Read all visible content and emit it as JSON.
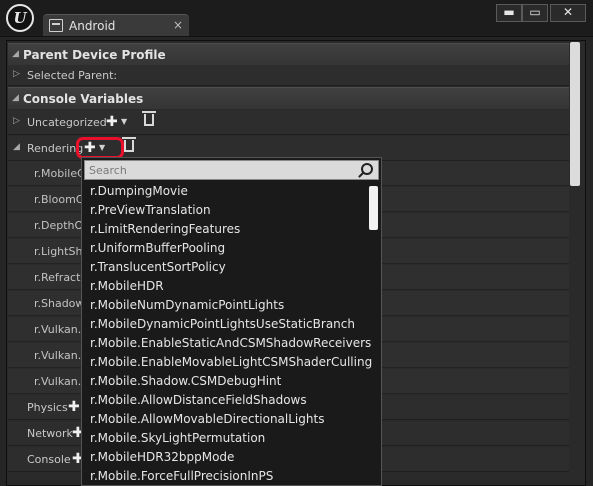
{
  "window": {
    "tab_label": "Android",
    "tab_close": "×",
    "minimize": "▬",
    "maximize": "▭",
    "close": "✕"
  },
  "sections": {
    "parent_device_profile": "Parent Device Profile",
    "selected_parent": "Selected Parent:",
    "console_variables": "Console Variables"
  },
  "rows": {
    "uncategorized": "Uncategorized",
    "rendering": "Rendering",
    "physics": "Physics",
    "network": "Network",
    "console": "Console"
  },
  "rendering_vars": [
    "r.MobileC",
    "r.BloomQ",
    "r.DepthOf",
    "r.LightSh",
    "r.Refracti",
    "r.Shadow",
    "r.Vulkan.I",
    "r.Vulkan.I",
    "r.Vulkan.I"
  ],
  "dropdown": {
    "search_placeholder": "Search",
    "items": [
      "r.DumpingMovie",
      "r.PreViewTranslation",
      "r.LimitRenderingFeatures",
      "r.UniformBufferPooling",
      "r.TranslucentSortPolicy",
      "r.MobileHDR",
      "r.MobileNumDynamicPointLights",
      "r.MobileDynamicPointLightsUseStaticBranch",
      "r.Mobile.EnableStaticAndCSMShadowReceivers",
      "r.Mobile.EnableMovableLightCSMShaderCulling",
      "r.Mobile.Shadow.CSMDebugHint",
      "r.Mobile.AllowDistanceFieldShadows",
      "r.Mobile.AllowMovableDirectionalLights",
      "r.Mobile.SkyLightPermutation",
      "r.MobileHDR32bppMode",
      "r.Mobile.ForceFullPrecisionInPS"
    ]
  },
  "icons": {
    "logo": "unreal-logo-icon",
    "tab": "device-icon",
    "search": "search-icon",
    "add": "plus-icon",
    "delete": "trash-icon"
  },
  "colors": {
    "highlight": "#e8102c",
    "background": "#252525"
  }
}
